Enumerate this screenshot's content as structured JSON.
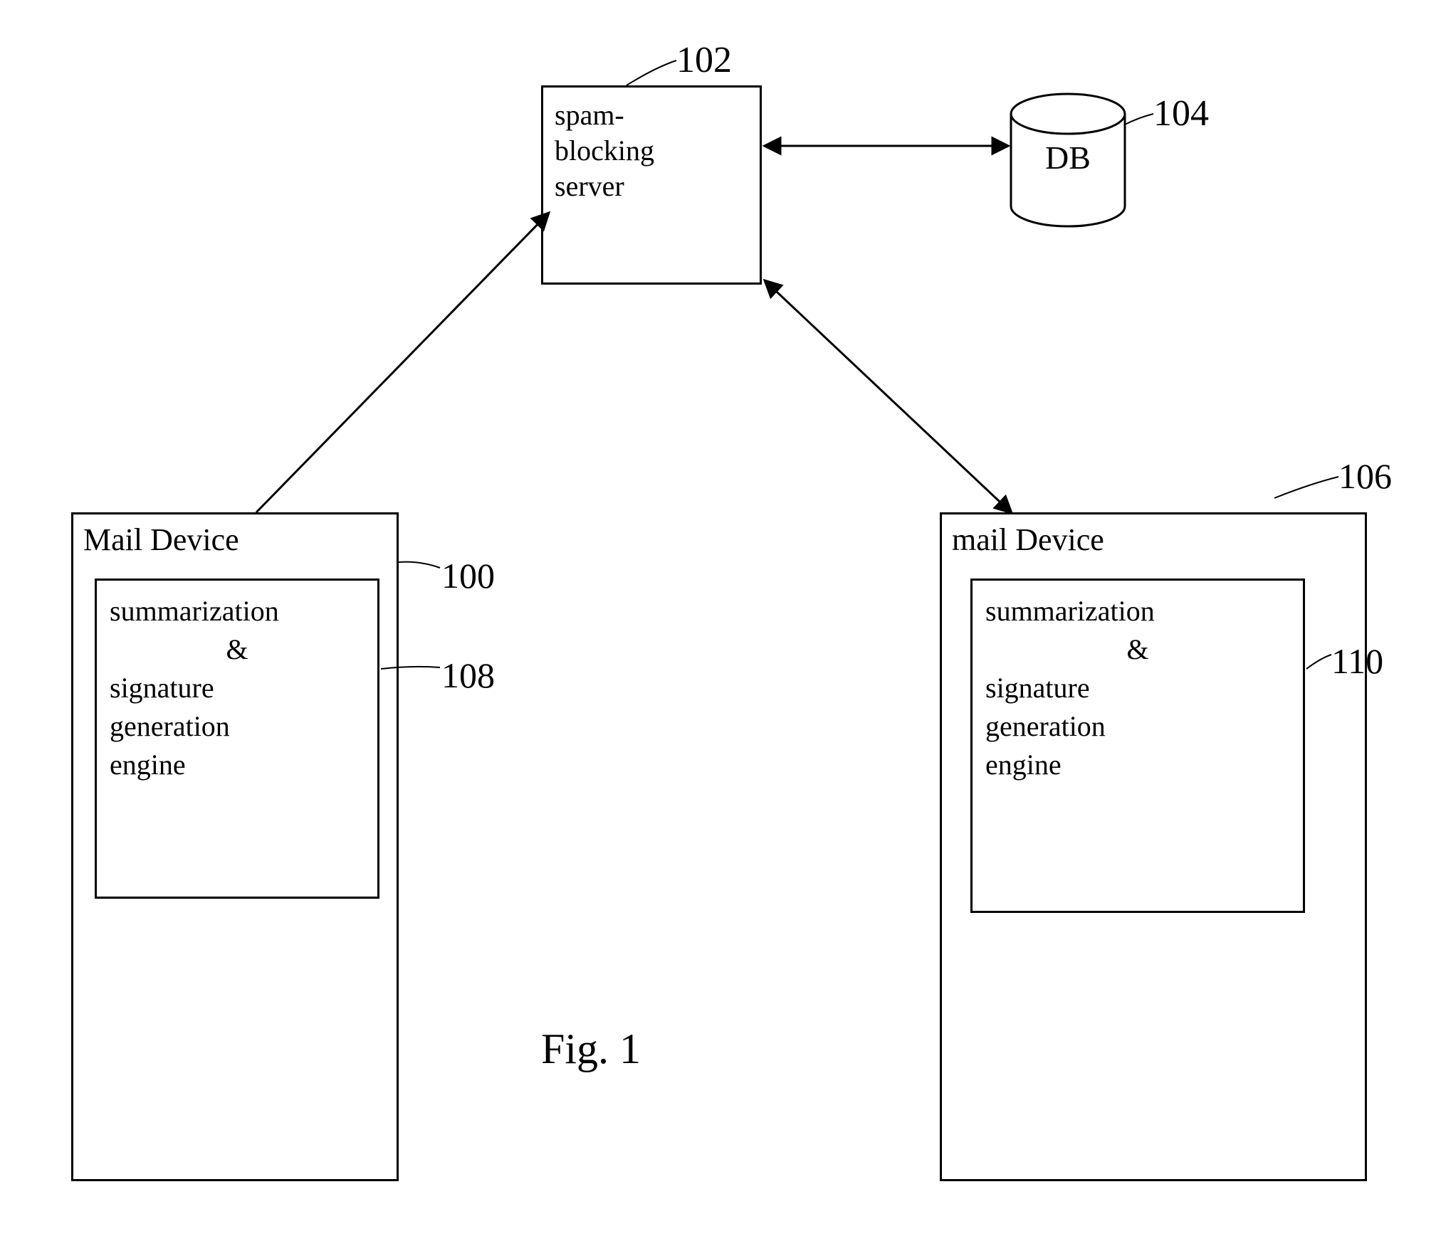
{
  "diagram": {
    "server": {
      "line1": "spam-",
      "line2": "blocking",
      "line3": "server",
      "ref": "102"
    },
    "db": {
      "label": "DB",
      "ref": "104"
    },
    "mail_left": {
      "title": "Mail Device",
      "ref": "100",
      "engine_ref": "108",
      "engine": {
        "l1": "summarization",
        "l2": "&",
        "l3": "signature",
        "l4": "generation",
        "l5": "engine"
      }
    },
    "mail_right": {
      "title": "mail Device",
      "ref": "106",
      "engine_ref": "110",
      "engine": {
        "l1": "summarization",
        "l2": "&",
        "l3": "signature",
        "l4": "generation",
        "l5": "engine"
      }
    },
    "figure_label": "Fig.    1"
  }
}
